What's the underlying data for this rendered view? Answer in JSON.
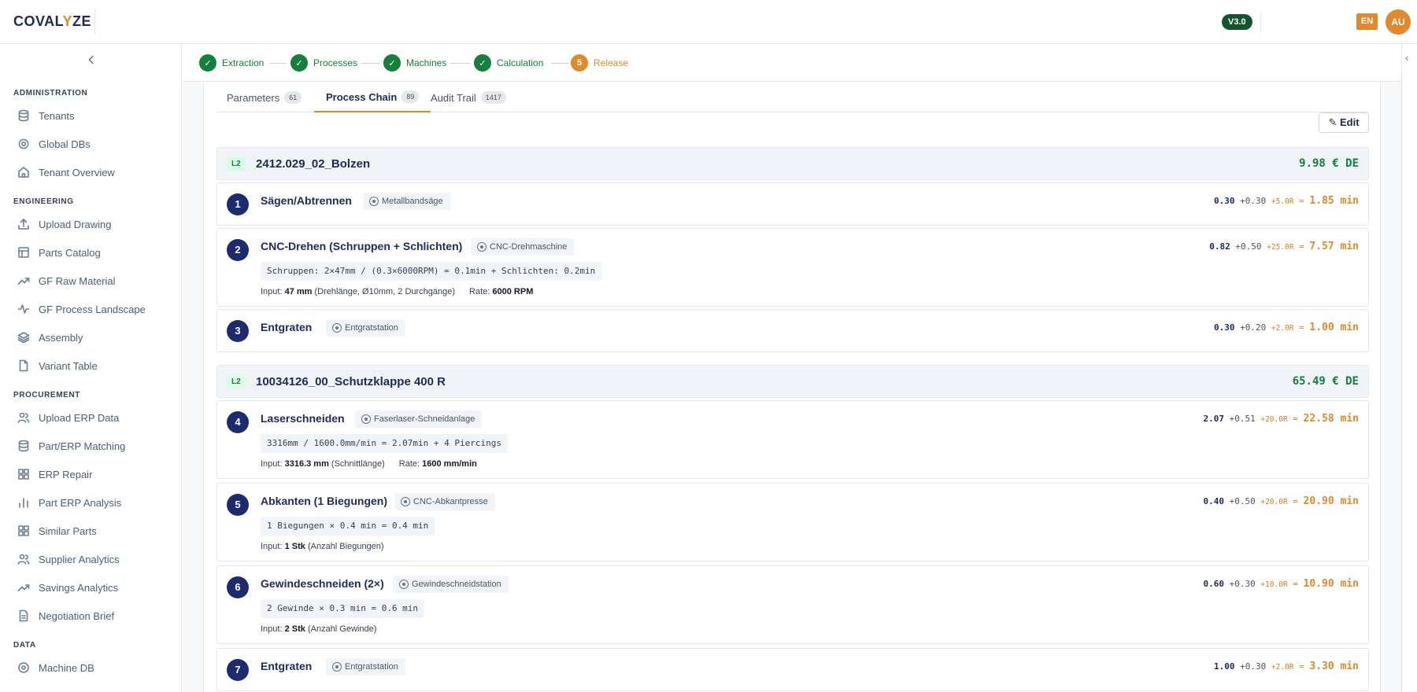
{
  "header": {
    "logo_pre": "COVAL",
    "logo_accent": "Y",
    "logo_post": "ZE",
    "version": "V3.0",
    "language": "EN",
    "avatar": "AU"
  },
  "sidebar": {
    "sections": [
      {
        "title": "ADMINISTRATION",
        "items": [
          {
            "label": "Tenants",
            "icon": "database-icon"
          },
          {
            "label": "Global DBs",
            "icon": "gear-icon"
          },
          {
            "label": "Tenant Overview",
            "icon": "home-icon"
          }
        ]
      },
      {
        "title": "ENGINEERING",
        "items": [
          {
            "label": "Upload Drawing",
            "icon": "upload-icon"
          },
          {
            "label": "Parts Catalog",
            "icon": "table-icon"
          },
          {
            "label": "GF Raw Material",
            "icon": "trend-icon"
          },
          {
            "label": "GF Process Landscape",
            "icon": "activity-icon"
          },
          {
            "label": "Assembly",
            "icon": "layers-icon"
          },
          {
            "label": "Variant Table",
            "icon": "file-icon"
          }
        ]
      },
      {
        "title": "PROCUREMENT",
        "items": [
          {
            "label": "Upload ERP Data",
            "icon": "users-icon"
          },
          {
            "label": "Part/ERP Matching",
            "icon": "database-icon"
          },
          {
            "label": "ERP Repair",
            "icon": "grid-icon"
          },
          {
            "label": "Part ERP Analysis",
            "icon": "bar-chart-icon"
          },
          {
            "label": "Similar Parts",
            "icon": "grid-icon"
          },
          {
            "label": "Supplier Analytics",
            "icon": "users-icon"
          },
          {
            "label": "Savings Analytics",
            "icon": "trend-icon"
          },
          {
            "label": "Negotiation Brief",
            "icon": "document-icon"
          }
        ]
      },
      {
        "title": "DATA",
        "items": [
          {
            "label": "Machine DB",
            "icon": "target-icon"
          }
        ]
      }
    ]
  },
  "stepper": {
    "steps": [
      {
        "label": "Extraction",
        "marker": "✓",
        "state": "done"
      },
      {
        "label": "Processes",
        "marker": "✓",
        "state": "done"
      },
      {
        "label": "Machines",
        "marker": "✓",
        "state": "done"
      },
      {
        "label": "Calculation",
        "marker": "✓",
        "state": "done"
      },
      {
        "label": "Release",
        "marker": "5",
        "state": "active"
      }
    ]
  },
  "tabs": [
    {
      "label": "Parameters",
      "count": "61"
    },
    {
      "label": "Process Chain",
      "count": "89"
    },
    {
      "label": "Audit Trail",
      "count": "1417"
    }
  ],
  "edit_label": "✎ Edit",
  "groups": [
    {
      "level": "L2",
      "name": "2412.029_02_Bolzen",
      "total": "9.98 € DE"
    },
    {
      "level": "L2",
      "name": "10034126_00_Schutzklappe 400 R",
      "total": "65.49 € DE"
    }
  ],
  "processes": [
    {
      "num": "1",
      "name": "Sägen/Abtrennen",
      "machine": "Metallbandsäge",
      "base": "0.30",
      "add": "+0.30",
      "setup": "+5.0R",
      "eq": "=",
      "total": "1.85 min"
    },
    {
      "num": "2",
      "name": "CNC-Drehen (Schruppen + Schlichten)",
      "machine": "CNC-Drehmaschine",
      "formula": "Schruppen: 2×47mm / (0.3×6000RPM) = 0.1min + Schlichten: 0.2min",
      "input_prefix": "Input:",
      "input_value": "47 mm",
      "input_desc": "(Drehlänge, Ø10mm, 2 Durchgänge)",
      "rate_prefix": "Rate:",
      "rate_value": "6000 RPM",
      "base": "0.82",
      "add": "+0.50",
      "setup": "+25.0R",
      "eq": "=",
      "total": "7.57 min"
    },
    {
      "num": "3",
      "name": "Entgraten",
      "machine": "Entgratstation",
      "base": "0.30",
      "add": "+0.20",
      "setup": "+2.0R",
      "eq": "=",
      "total": "1.00 min"
    },
    {
      "num": "4",
      "name": "Laserschneiden",
      "machine": "Faserlaser-Schneidanlage",
      "formula": "3316mm / 1600.0mm/min = 2.07min + 4 Piercings",
      "input_prefix": "Input:",
      "input_value": "3316.3 mm",
      "input_desc": "(Schnittlänge)",
      "rate_prefix": "Rate:",
      "rate_value": "1600 mm/min",
      "base": "2.07",
      "add": "+0.51",
      "setup": "+20.0R",
      "eq": "=",
      "total": "22.58 min"
    },
    {
      "num": "5",
      "name": "Abkanten (1 Biegungen)",
      "machine": "CNC-Abkantpresse",
      "formula": "1 Biegungen × 0.4 min = 0.4 min",
      "input_prefix": "Input:",
      "input_value": "1 Stk",
      "input_desc": "(Anzahl Biegungen)",
      "base": "0.40",
      "add": "+0.50",
      "setup": "+20.0R",
      "eq": "=",
      "total": "20.90 min"
    },
    {
      "num": "6",
      "name": "Gewindeschneiden (2×)",
      "machine": "Gewindeschneidstation",
      "formula": "2 Gewinde × 0.3 min = 0.6 min",
      "input_prefix": "Input:",
      "input_value": "2 Stk",
      "input_desc": "(Anzahl Gewinde)",
      "base": "0.60",
      "add": "+0.30",
      "setup": "+10.0R",
      "eq": "=",
      "total": "10.90 min"
    },
    {
      "num": "7",
      "name": "Entgraten",
      "machine": "Entgratstation",
      "base": "1.00",
      "add": "+0.30",
      "setup": "+2.0R",
      "eq": "=",
      "total": "3.30 min"
    }
  ]
}
